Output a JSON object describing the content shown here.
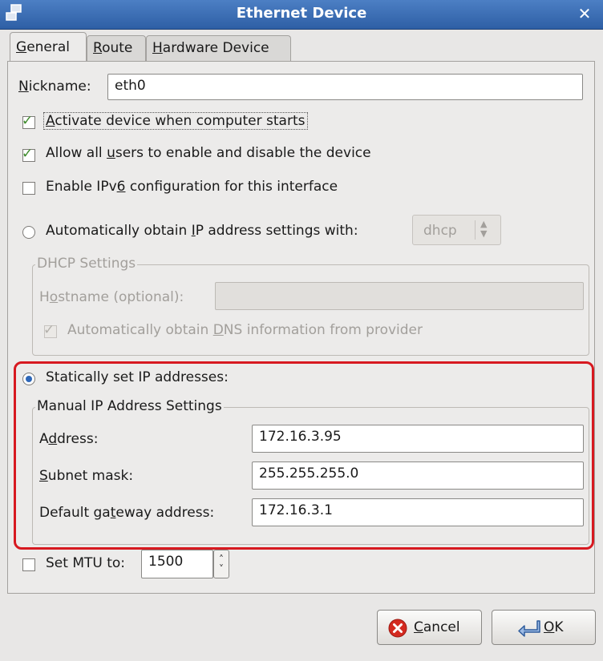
{
  "window": {
    "title": "Ethernet Device",
    "close_label": "✕"
  },
  "tabs": [
    {
      "label": "General",
      "u": "G",
      "rest": "eneral"
    },
    {
      "label": "Route",
      "u": "R",
      "rest": "oute"
    },
    {
      "label": "Hardware Device",
      "u": "H",
      "rest": "ardware Device"
    }
  ],
  "general": {
    "nickname_label_u": "N",
    "nickname_label_rest": "ickname:",
    "nickname_value": "eth0",
    "activate_u": "A",
    "activate_rest": "ctivate device when computer starts",
    "activate_checked": true,
    "allow_users_a": "Allow all ",
    "allow_users_u": "u",
    "allow_users_b": "sers to enable and disable the device",
    "allow_users_checked": true,
    "ipv6_a": "Enable IPv",
    "ipv6_u": "6",
    "ipv6_b": " configuration for this interface",
    "ipv6_checked": false
  },
  "auto_ip": {
    "label_a": "Automatically obtain ",
    "label_u": "I",
    "label_b": "P address settings with:",
    "selected": false,
    "protocol": "dhcp"
  },
  "dhcp": {
    "frame_title": "DHCP Settings",
    "hostname_a": "H",
    "hostname_u": "o",
    "hostname_b": "stname (optional):",
    "hostname_value": "",
    "dns_a": "Automatically obtain ",
    "dns_u": "D",
    "dns_b": "NS information from provider",
    "dns_checked": true
  },
  "static_ip": {
    "label": "Statically set IP addresses:",
    "selected": true,
    "frame_title": "Manual IP Address Settings",
    "address_a": "A",
    "address_u": "d",
    "address_b": "dress:",
    "address_value": "172.16.3.95",
    "subnet_u": "S",
    "subnet_b": "ubnet mask:",
    "subnet_value": "255.255.255.0",
    "gateway_a": "Default ga",
    "gateway_u": "t",
    "gateway_b": "eway address:",
    "gateway_value": "172.16.3.1"
  },
  "mtu": {
    "label": "Set MTU to:",
    "value": "1500",
    "checked": false
  },
  "buttons": {
    "cancel_u": "C",
    "cancel_b": "ancel",
    "ok_u": "O",
    "ok_b": "K"
  },
  "colors": {
    "titlebar": "#2e5fa5",
    "highlight": "#d71920",
    "radio_dot": "#2e67b8",
    "check": "#3d8a2a"
  }
}
